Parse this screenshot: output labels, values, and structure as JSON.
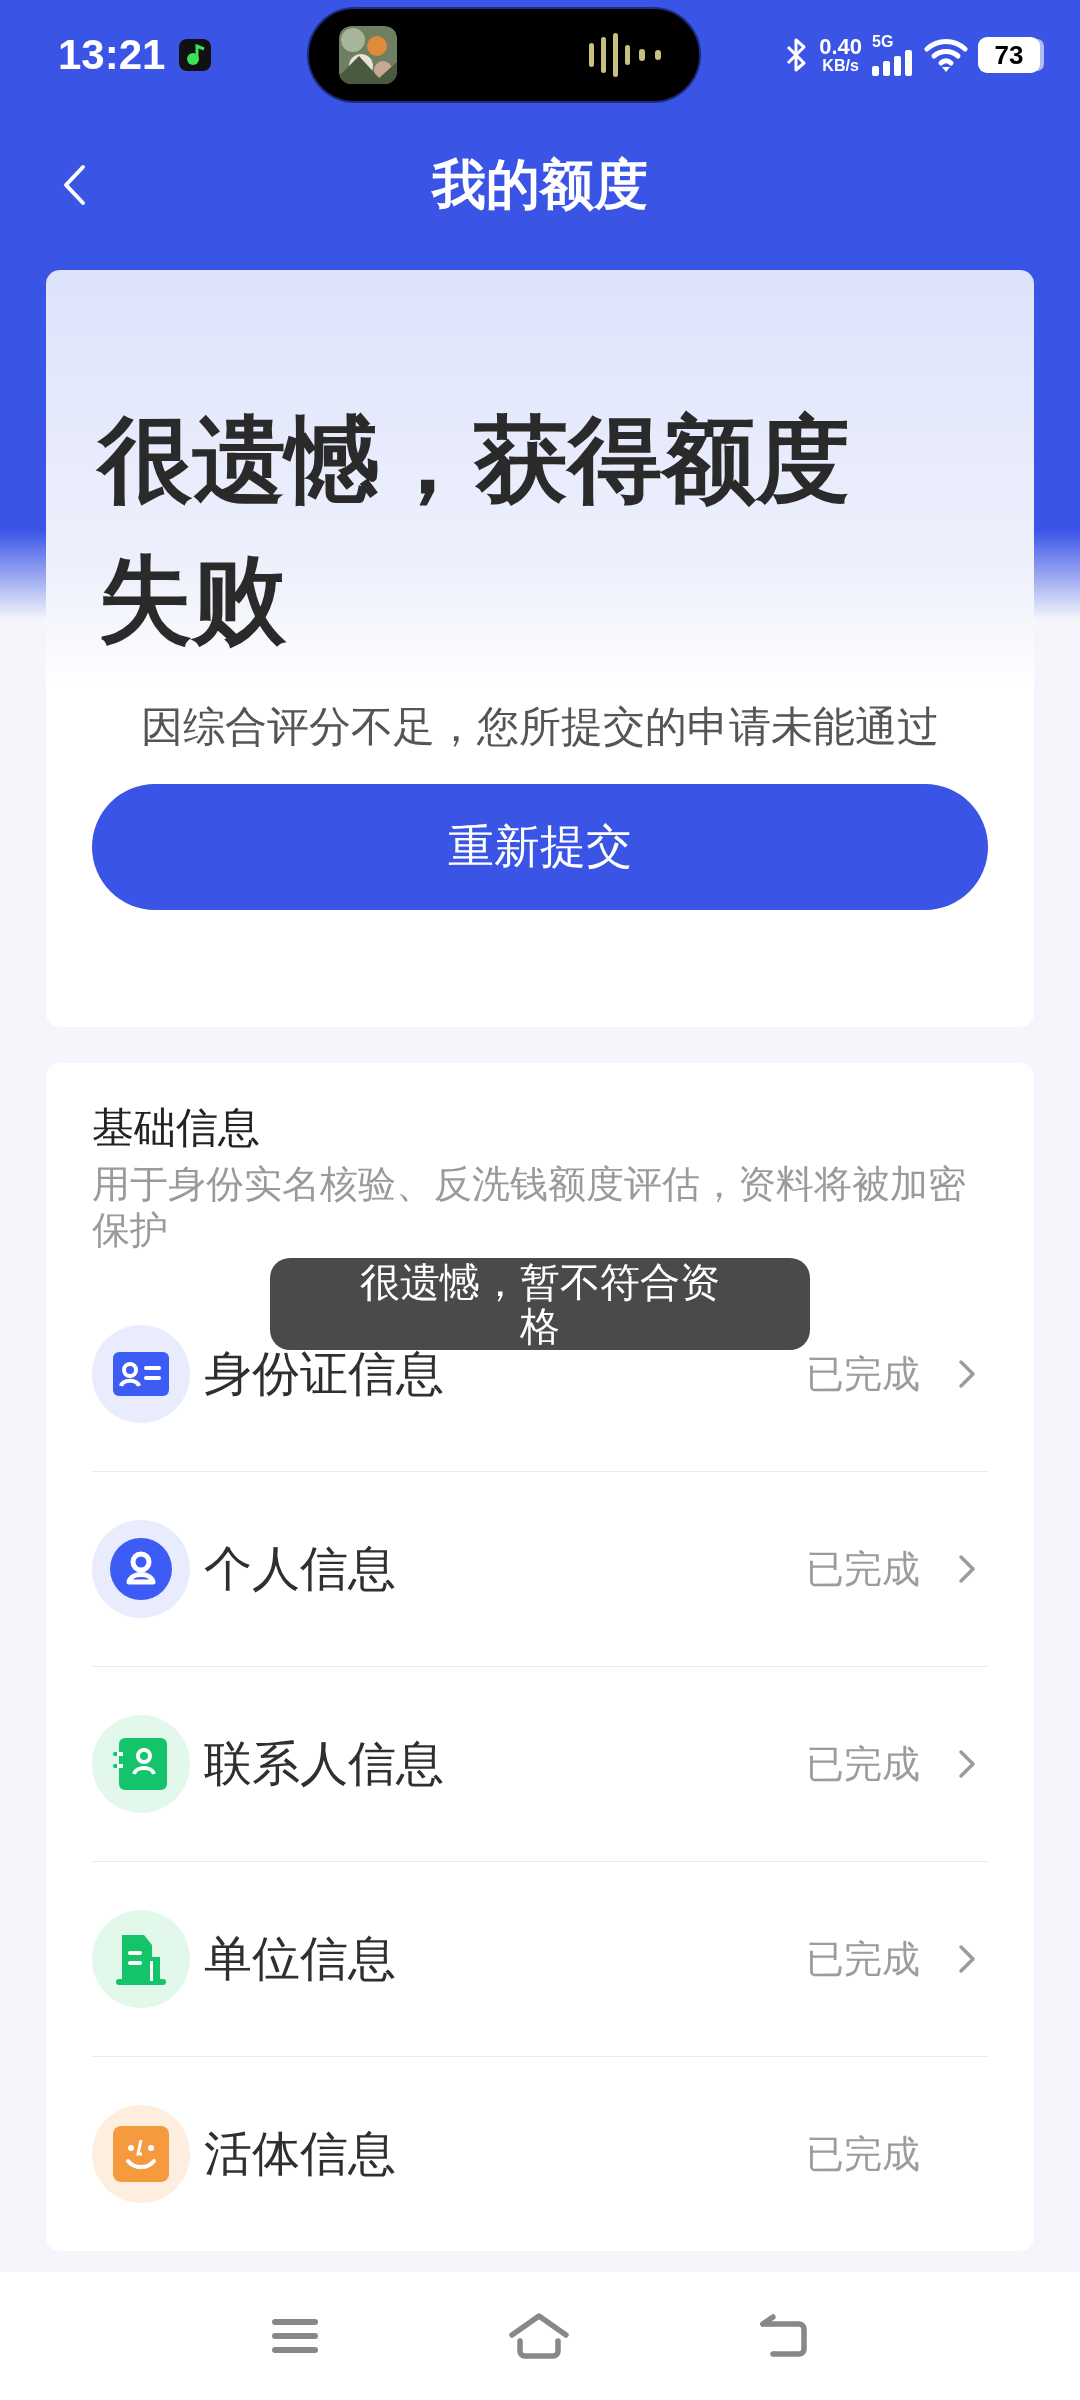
{
  "status_bar": {
    "time": "13:21",
    "speed_value": "0.40",
    "speed_unit": "KB/s",
    "network": "5G",
    "battery": "73"
  },
  "header": {
    "title": "我的额度"
  },
  "result_card": {
    "title": "很遗憾，获得额度失败",
    "message": "因综合评分不足，您所提交的申请未能通过",
    "button": "重新提交"
  },
  "info_section": {
    "title": "基础信息",
    "description": "用于身份实名核验、反洗钱额度评估，资料将被加密保护",
    "items": [
      {
        "kind": "id-card",
        "label": "身份证信息",
        "status": "已完成",
        "has_arrow": true
      },
      {
        "kind": "person",
        "label": "个人信息",
        "status": "已完成",
        "has_arrow": true
      },
      {
        "kind": "contact",
        "label": "联系人信息",
        "status": "已完成",
        "has_arrow": true
      },
      {
        "kind": "building",
        "label": "单位信息",
        "status": "已完成",
        "has_arrow": true
      },
      {
        "kind": "face",
        "label": "活体信息",
        "status": "已完成",
        "has_arrow": false
      }
    ]
  },
  "toast": {
    "message": "很遗憾，暂不符合资格"
  }
}
